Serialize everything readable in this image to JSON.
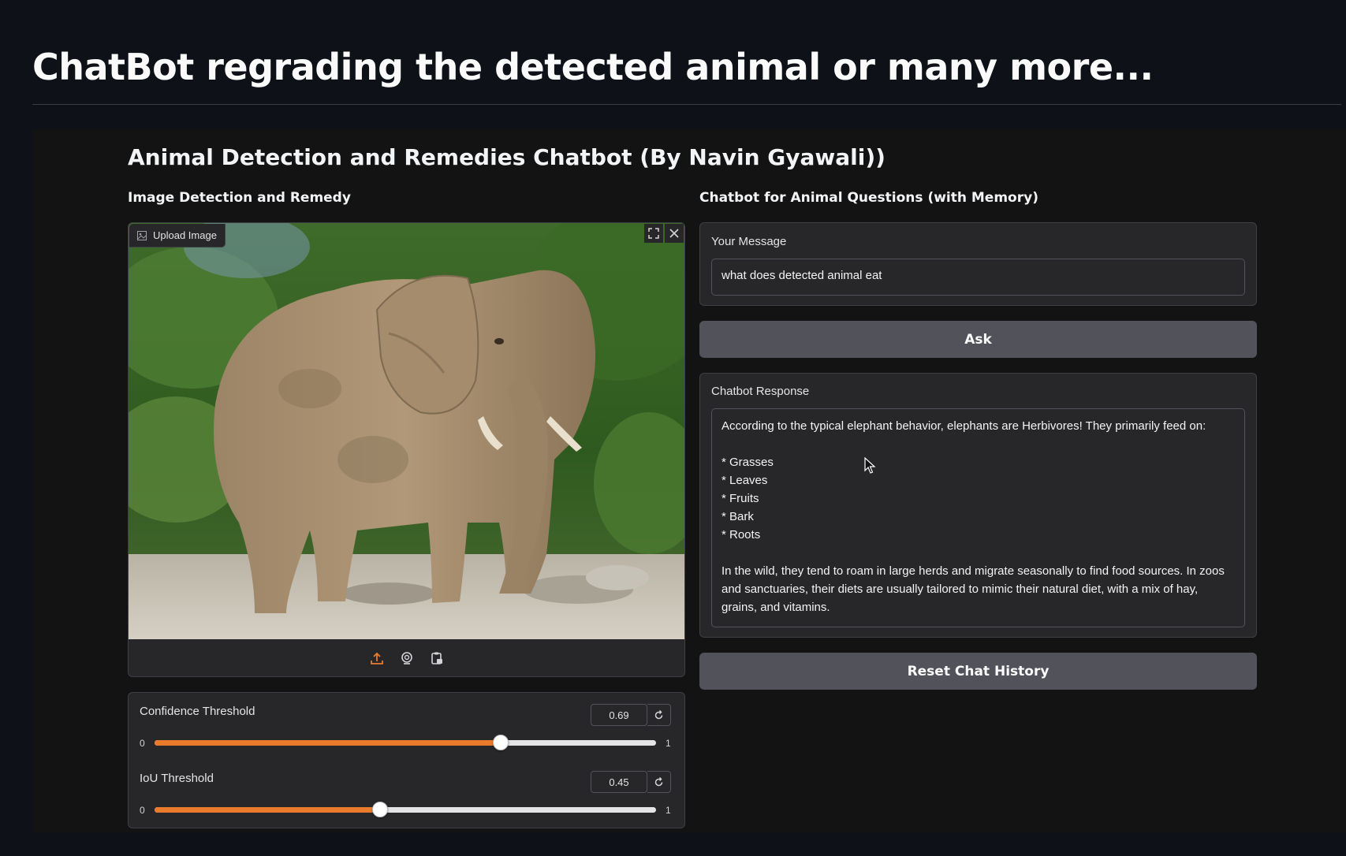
{
  "page": {
    "title": "ChatBot regrading the detected animal or many more..."
  },
  "app": {
    "title": "Animal Detection and Remedies Chatbot (By Navin Gyawali))"
  },
  "left": {
    "section_title": "Image Detection and Remedy",
    "upload_label": "Upload Image",
    "image_subject": "elephant",
    "sliders": [
      {
        "label": "Confidence Threshold",
        "value": "0.69",
        "min": "0",
        "max": "1",
        "fraction": 0.69
      },
      {
        "label": "IoU Threshold",
        "value": "0.45",
        "min": "0",
        "max": "1",
        "fraction": 0.45
      }
    ]
  },
  "right": {
    "section_title": "Chatbot for Animal Questions (with Memory)",
    "message_label": "Your Message",
    "message_value": "what does detected animal eat",
    "ask_button": "Ask",
    "response_label": "Chatbot Response",
    "response_text": "According to the typical elephant behavior, elephants are Herbivores! They primarily feed on:\n\n* Grasses\n* Leaves\n* Fruits\n* Bark\n* Roots\n\nIn the wild, they tend to roam in large herds and migrate seasonally to find food sources. In zoos and sanctuaries, their diets are usually tailored to mimic their natural diet, with a mix of hay, grains, and vitamins.",
    "reset_button": "Reset Chat History"
  },
  "colors": {
    "background": "#0e1117",
    "panel": "#27272a",
    "accent": "#ea7b2c",
    "button": "#52525b"
  }
}
